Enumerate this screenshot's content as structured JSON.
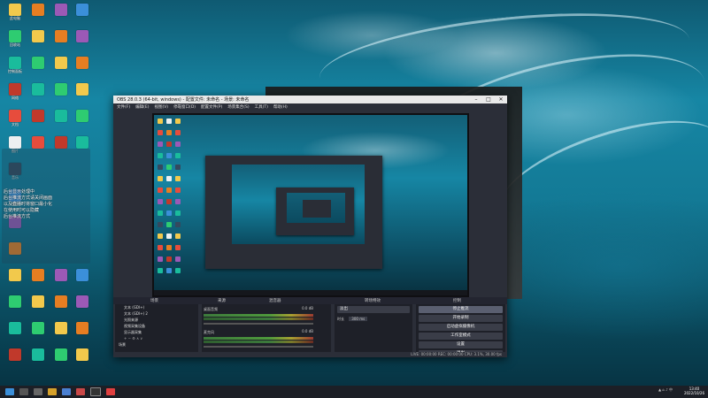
{
  "obs": {
    "title": "OBS 28.0.3 (64-bit, windows) - 配置文件: 未命名 - 场景: 未命名",
    "menus": [
      "文件(F)",
      "编辑(E)",
      "视图(V)",
      "停靠窗口(D)",
      "配置文件(P)",
      "场景集合(S)",
      "工具(T)",
      "帮助(H)"
    ],
    "dock_headers": {
      "scenes": "场景",
      "sources": "来源",
      "mixer": "混音器",
      "transitions": "转场特效",
      "controls": "控制"
    },
    "scenes": [
      "场景"
    ],
    "sources": [
      "文本 (GDI+)",
      "文本 (GDI+) 2",
      "光照来源",
      "视频采集设备",
      "显示器采集"
    ],
    "mixer_tracks": [
      {
        "name": "桌面音频",
        "db": "0.0 dB"
      },
      {
        "name": "麦克风",
        "db": "0.0 dB"
      }
    ],
    "transition": {
      "type": "淡出",
      "duration_label": "时长",
      "duration": "300 ms"
    },
    "controls": [
      "停止推流",
      "开始录制",
      "启动虚拟摄像机",
      "工作室模式",
      "设置",
      "退出"
    ],
    "status": "LIVE: 00:00:00   REC: 00:00:00   CPU: 3.1%, 30.00 fps"
  },
  "desktop_labels": [
    "此电脑",
    "回收站",
    "控制面板",
    "网络",
    "文档",
    "图片",
    "音乐",
    "视频"
  ],
  "notepad_lines": [
    "后台显示处理中",
    "后台推流方式请关闭画面",
    "以及直播时将窗口最小化",
    "在使用时可以隐藏",
    "后台推流方式"
  ],
  "taskbar": {
    "clock_time": "13:40",
    "clock_date": "2022/10/26"
  },
  "colors": {
    "obs_bg": "#2b2e38",
    "panel_bg": "#1e2028",
    "accent": "#1686a4"
  }
}
